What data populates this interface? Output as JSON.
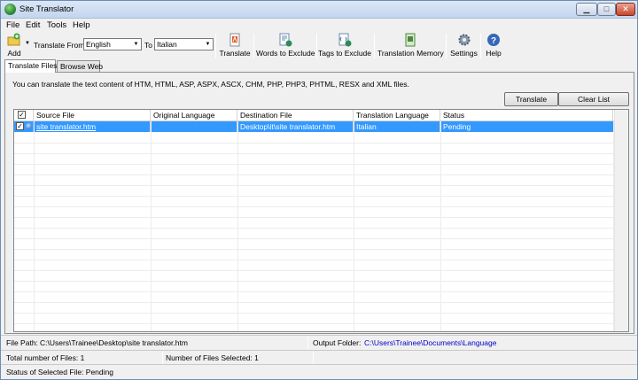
{
  "window": {
    "title": "Site Translator"
  },
  "menu": [
    "File",
    "Edit",
    "Tools",
    "Help"
  ],
  "toolbar": {
    "add_label": "Add",
    "translate_from_label": "Translate From",
    "from_value": "English",
    "to_label": "To",
    "to_value": "Italian",
    "buttons": [
      "Translate",
      "Words to Exclude",
      "Tags to Exclude",
      "Translation Memory",
      "Settings",
      "Help"
    ]
  },
  "tabs": [
    "Translate Files",
    "Browse Web"
  ],
  "panel": {
    "info": "You can translate the text content of HTM, HTML, ASP, ASPX, ASCX, CHM, PHP, PHP3, PHTML, RESX and XML files.",
    "translate_button": "Translate",
    "clear_button": "Clear List"
  },
  "grid": {
    "columns": [
      "Source File",
      "Original Language",
      "Destination File",
      "Translation Language",
      "Status"
    ],
    "rows": [
      {
        "checked": true,
        "source": "site translator.htm",
        "original": "",
        "destination": "Desktop\\it\\site translator.htm",
        "language": "Italian",
        "status": "Pending"
      }
    ]
  },
  "statusbar": {
    "file_path_label": "File Path:",
    "file_path": "C:\\Users\\Trainee\\Desktop\\site translator.htm",
    "output_label": "Output Folder:",
    "output_folder": "C:\\Users\\Trainee\\Documents\\Language",
    "total_files": "Total number of Files: 1",
    "selected_files": "Number of Files Selected: 1",
    "selected_status": "Status of Selected File: Pending"
  },
  "colors": {
    "selection": "#3399ff",
    "link": "#0000cc",
    "titlebar": "#c3d6ee"
  }
}
